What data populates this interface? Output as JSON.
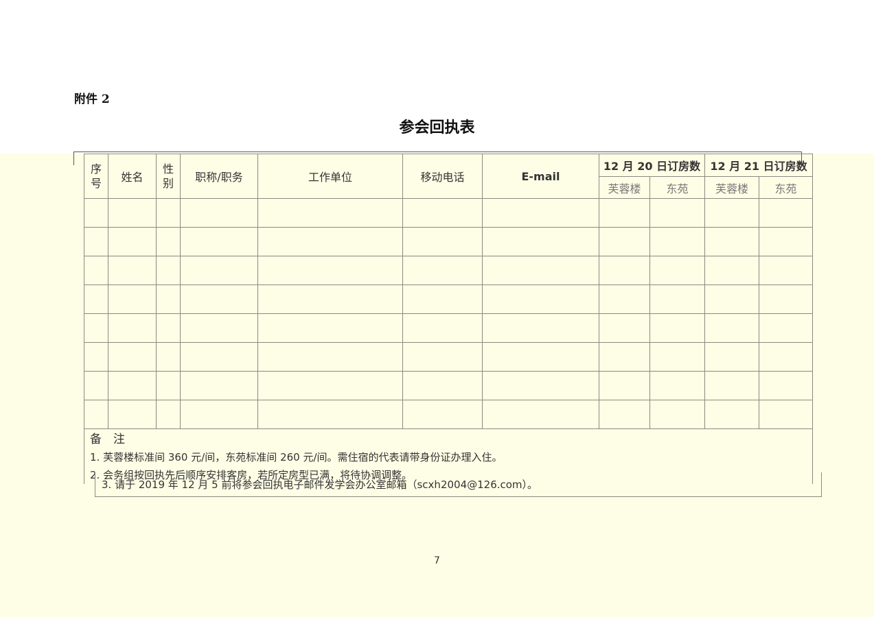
{
  "attachment_label": "附件 2",
  "title": "参会回执表",
  "table": {
    "headers": {
      "seq": [
        "序",
        "号"
      ],
      "name": "姓名",
      "gender": [
        "性",
        "别"
      ],
      "position": "职称/职务",
      "unit": "工作单位",
      "phone": "移动电话",
      "email": "E-mail",
      "dec20": "12 月 20 日订房数",
      "dec21": "12 月 21 日订房数",
      "sub": [
        "芙蓉楼",
        "东苑",
        "芙蓉楼",
        "东苑"
      ]
    },
    "notes_title": "备　注",
    "notes": [
      "1.  芙蓉楼标准间 360 元/间，东苑标准间 260 元/间。需住宿的代表请带身份证办理入住。",
      "2.  会务组按回执先后顺序安排客房，若所定房型已满，将待协调调整。",
      "3.  请于 2019 年 12 月 5 前将参会回执电子邮件发学会办公室邮箱（scxh2004@126.com）。"
    ]
  },
  "page_number": "7"
}
